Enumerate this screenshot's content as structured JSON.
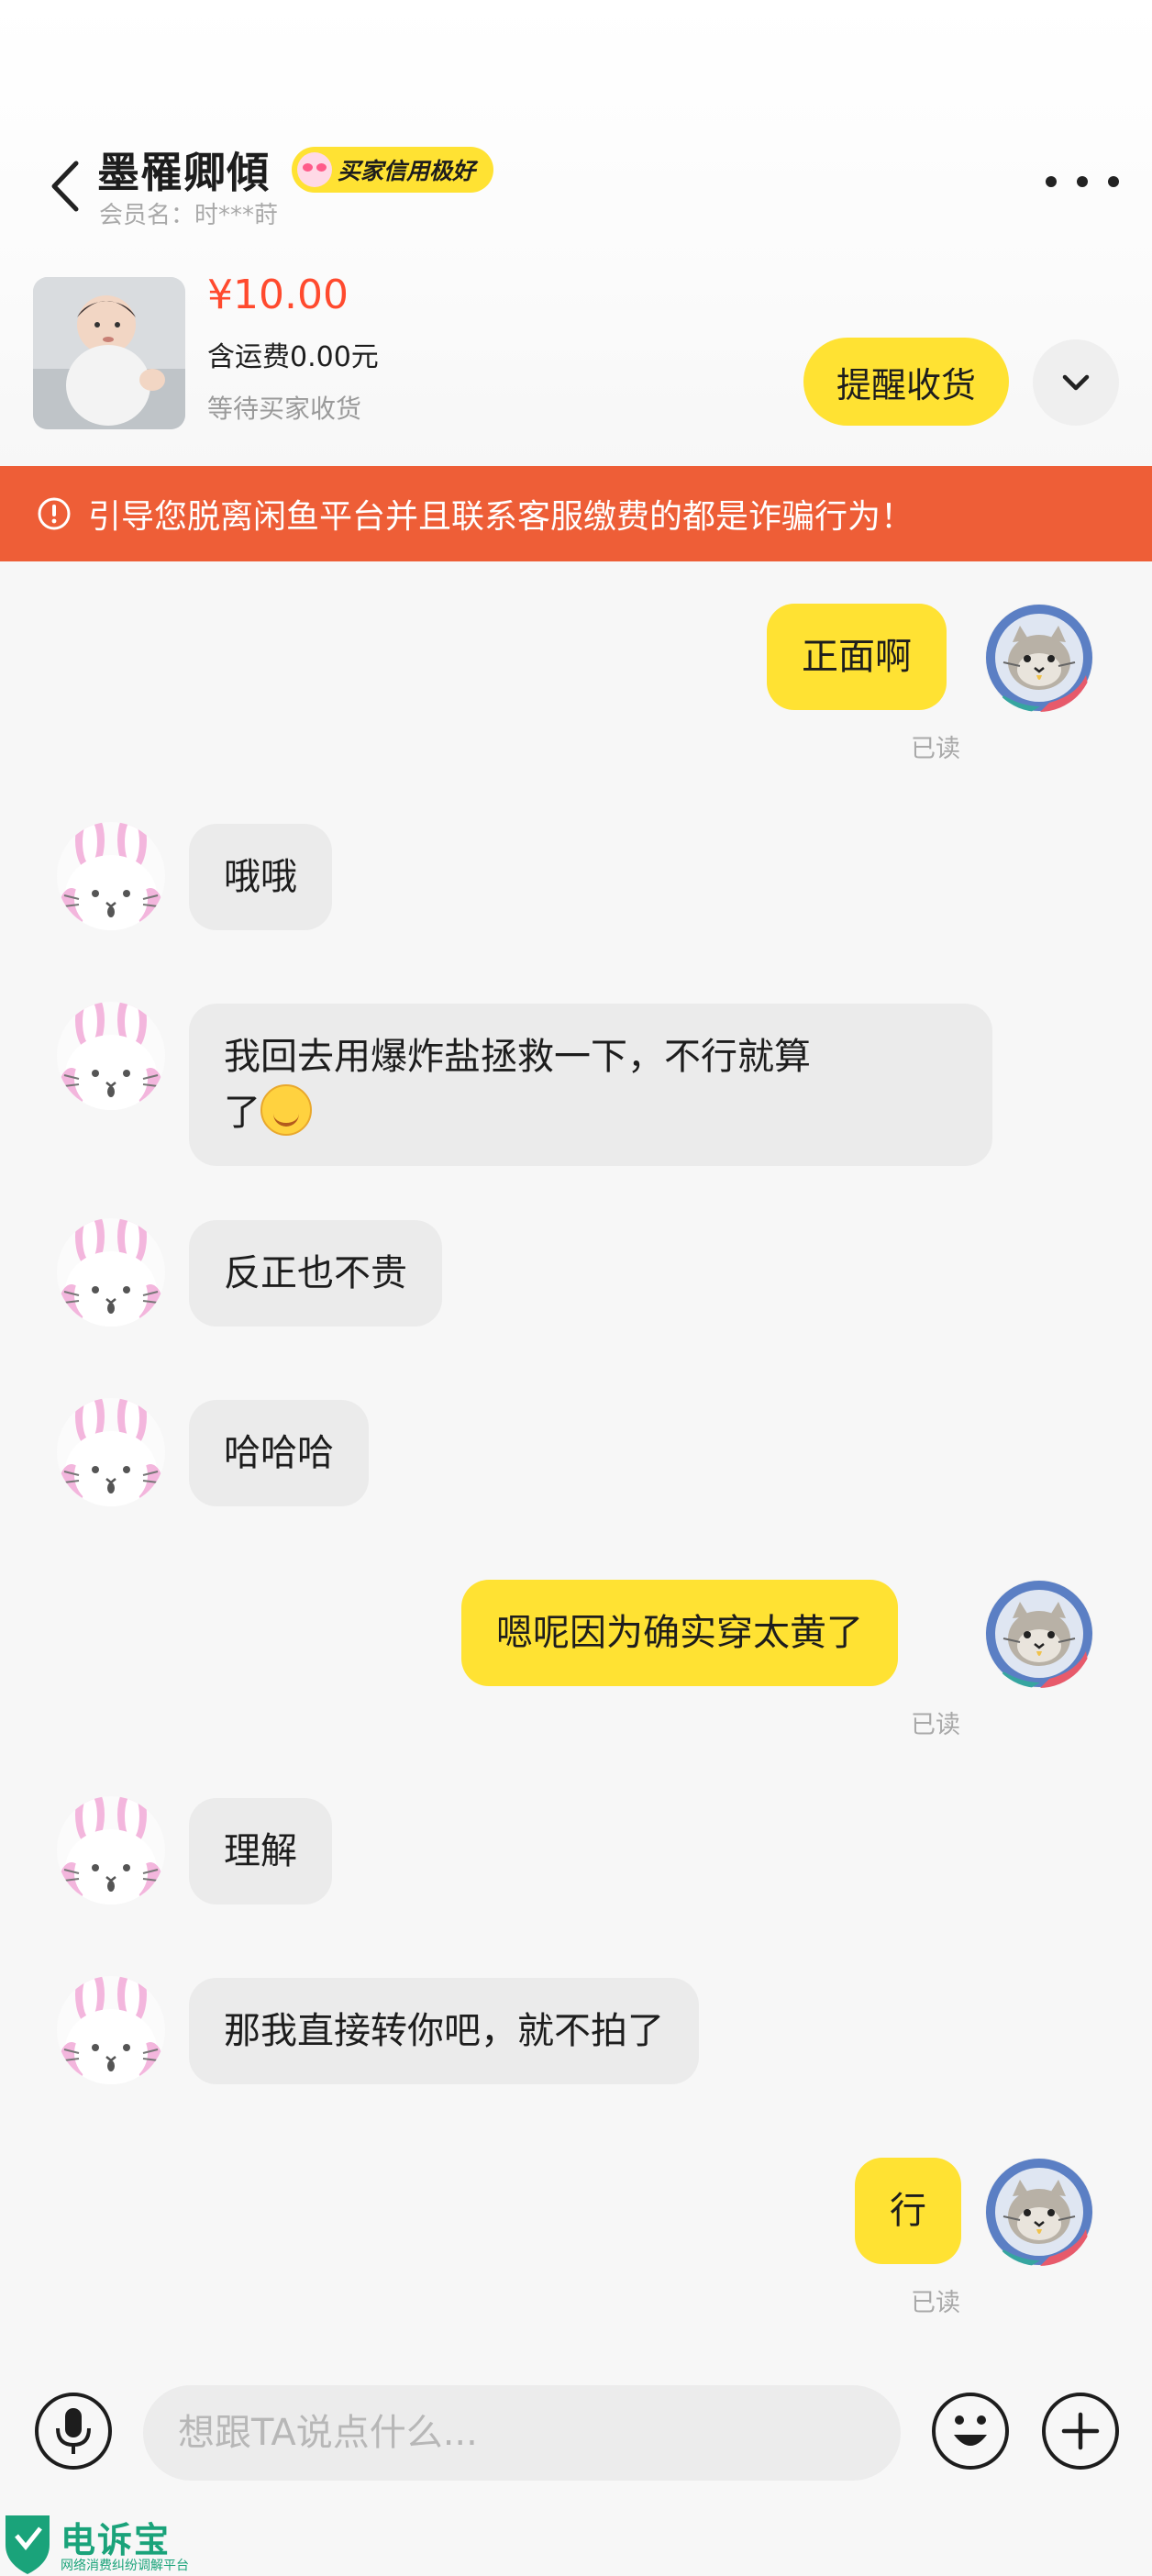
{
  "header": {
    "title": "墨罹卿傾",
    "badge": "买家信用极好",
    "member_label": "会员名：时***莳"
  },
  "order": {
    "price": "¥10.00",
    "shipping": "含运费0.00元",
    "status": "等待买家收货",
    "remind_button": "提醒收货"
  },
  "warning": {
    "text": "引导您脱离闲鱼平台并且联系客服缴费的都是诈骗行为！",
    "color": "#ee5e37"
  },
  "messages": [
    {
      "side": "out",
      "text": "正面啊",
      "read": "已读"
    },
    {
      "side": "in",
      "text": "哦哦"
    },
    {
      "side": "in",
      "text": "我回去用爆炸盐拯救一下，不行就算",
      "text2": "了",
      "emoji": "grinning-sweat-emoji"
    },
    {
      "side": "in",
      "text": "反正也不贵"
    },
    {
      "side": "in",
      "text": "哈哈哈"
    },
    {
      "side": "out",
      "text": "嗯呢因为确实穿太黄了",
      "read": "已读"
    },
    {
      "side": "in",
      "text": "理解"
    },
    {
      "side": "in",
      "text": "那我直接转你吧，就不拍了"
    },
    {
      "side": "out",
      "text": "行",
      "read": "已读"
    }
  ],
  "input": {
    "placeholder": "想跟TA说点什么..."
  },
  "watermark": {
    "name": "电诉宝",
    "subtitle": "网络消费纠纷调解平台"
  },
  "colors": {
    "accent_yellow": "#ffe233",
    "price_red": "#ff4a2e",
    "incoming_bubble": "#ebebeb"
  }
}
